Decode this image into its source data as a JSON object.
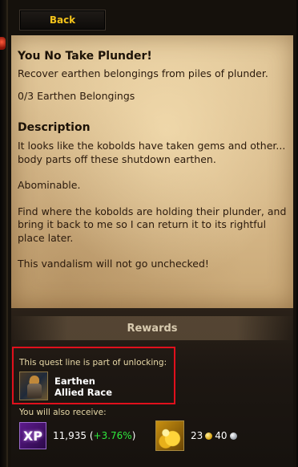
{
  "nav": {
    "back_label": "Back"
  },
  "quest": {
    "title": "You No Take Plunder!",
    "summary": "Recover earthen belongings from piles of plunder.",
    "objective": "0/3 Earthen Belongings",
    "description_heading": "Description",
    "description_paragraphs": [
      "It looks like the kobolds have taken gems and other... body parts off these shutdown earthen.",
      "Abominable.",
      "Find where the kobolds are holding their plunder, and bring it back to me so I can return it to its rightful place later.",
      "This vandalism will not go unchecked!"
    ]
  },
  "rewards": {
    "header": "Rewards",
    "unlock_label": "This quest line is part of unlocking:",
    "unlock_item": {
      "name": "Earthen Allied Race",
      "icon": "earthen-race-icon"
    },
    "also_label": "You will also receive:",
    "xp": {
      "icon_text": "XP",
      "amount": "11,935",
      "open_paren": "(",
      "bonus": "+3.76%",
      "close_paren": ")"
    },
    "money": {
      "gold": "23",
      "silver": "40"
    }
  },
  "colors": {
    "gold_text": "#f3c21a",
    "highlight_border": "#e0101c",
    "xp_bonus": "#2ee83c"
  }
}
